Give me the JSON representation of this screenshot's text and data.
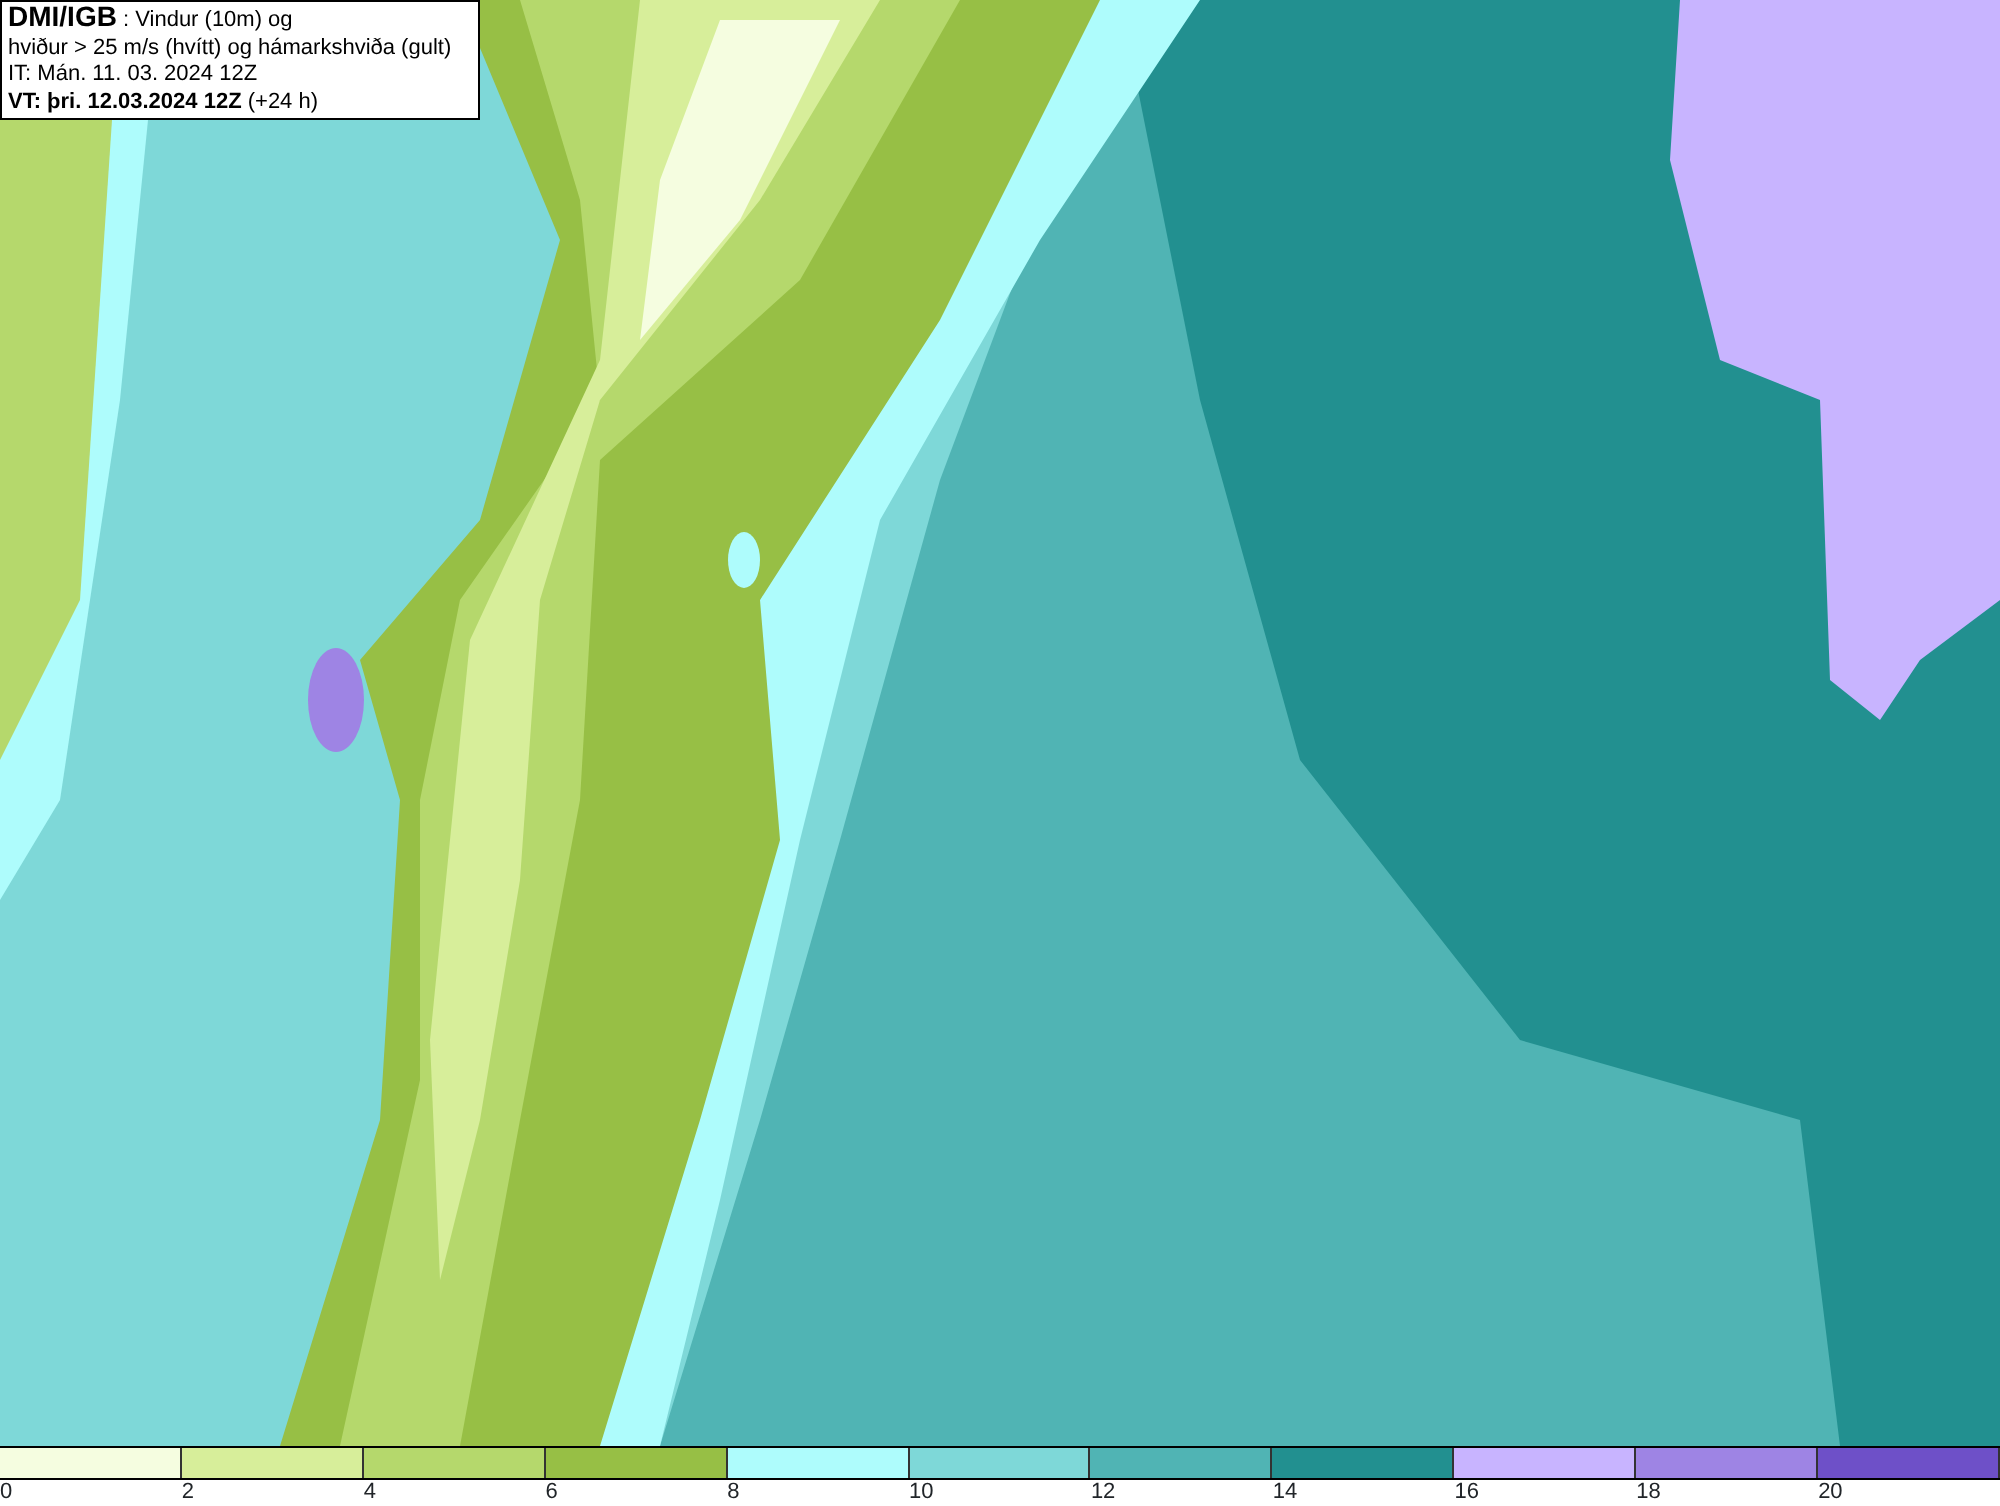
{
  "header": {
    "lines": [
      "**DMI/IGB** : Vindur (10m) og",
      "hviður > 25 m/s (hvítt) og hámarkshviða (gult)",
      "IT: Mán. 11. 03. 2024 12Z",
      "**VT: þri. 12.03.2024 12Z** (+24 h)"
    ]
  },
  "legend": {
    "swatches": [
      {
        "color": "#f5fde0"
      },
      {
        "color": "#d7ee9a"
      },
      {
        "color": "#b5d86c"
      },
      {
        "color": "#97bf45"
      },
      {
        "color": "#aefcfc"
      },
      {
        "color": "#7ed8d8"
      },
      {
        "color": "#50b4b4"
      },
      {
        "color": "#229090"
      },
      {
        "color": "#c8b4ff"
      },
      {
        "color": "#9e84e4"
      },
      {
        "color": "#6e50c8"
      }
    ],
    "ticks": [
      "0",
      "2",
      "4",
      "6",
      "8",
      "10",
      "12",
      "14",
      "16",
      "18",
      "20"
    ]
  }
}
